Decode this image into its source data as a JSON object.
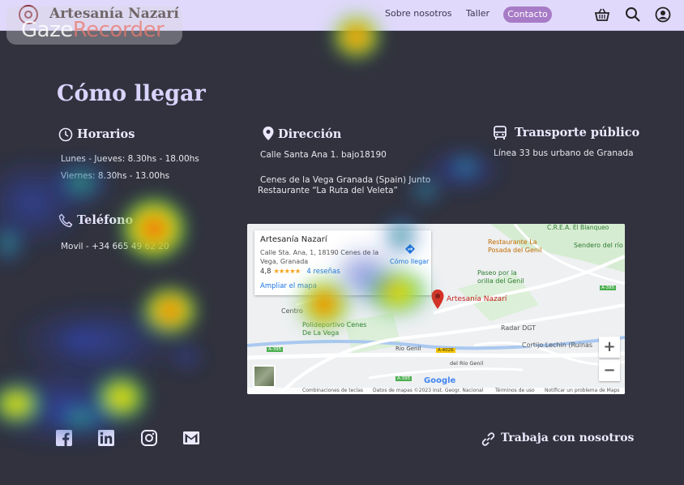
{
  "header": {
    "brand": "Artesanía Nazarí",
    "nav": {
      "about": "Sobre nosotros",
      "taller": "Taller",
      "contact": "Contacto"
    },
    "icons": [
      "basket-icon",
      "search-icon",
      "user-icon"
    ]
  },
  "overlay": {
    "name_a": "Gaze",
    "name_b": "Recorder"
  },
  "page_title": "Cómo llegar",
  "horarios": {
    "heading": "Horarios",
    "line1": "Lunes - Jueves: 8.30hs - 18.00hs",
    "line2": "Viernes: 8.30hs - 13.00hs"
  },
  "direccion": {
    "heading": "Dirección",
    "line1": "Calle Santa Ana 1. bajo18190",
    "line2": "Cenes de la Vega Granada (Spain) Junto",
    "line3": "Restaurante “La Ruta del Veleta”"
  },
  "transporte": {
    "heading": "Transporte público",
    "line1": "Línea 33 bus urbano de Granada"
  },
  "telefono": {
    "heading": "Teléfono",
    "line1": "Movil - +34 665 49 62 20"
  },
  "map": {
    "card_title": "Artesanía Nazarí",
    "card_address": "Calle Sta. Ana, 1, 18190 Cenes de la Vega, Granada",
    "rating": "4,8",
    "stars": "★★★★★",
    "reviews": "4 reseñas",
    "enlarge": "Ampliar el mapa",
    "directions": "Cómo llegar",
    "labels": {
      "pin": "Artesanía Nazarí",
      "restaurant": "Restaurante La Posada del Genil",
      "crea": "C.R.E.A. El Blanqueo",
      "sendero": "Sendero del río",
      "paseo": "Paseo por la orilla del Genil",
      "centro": "Centro",
      "polideportivo": "Polideportivo Cenes De La Vega",
      "radar": "Radar DGT",
      "cortijo": "Cortijo Lechin (Ruinas",
      "rio1": "Río Genil",
      "rio2": "del Río Genil",
      "a395a": "A-395",
      "a395b": "A-395",
      "a395c": "A-395",
      "a4026": "A-4026",
      "google": "Google"
    },
    "zoom_in": "+",
    "zoom_out": "−",
    "footer": {
      "keys": "Combinaciones de teclas",
      "data": "Datos de mapas ©2023 Inst. Geogr. Nacional",
      "terms": "Términos de uso",
      "report": "Notificar un problema de Maps"
    }
  },
  "footer": {
    "social": [
      "facebook-icon",
      "linkedin-icon",
      "instagram-icon",
      "mail-icon"
    ],
    "work_with_us": "Trabaja con nosotros"
  },
  "colors": {
    "background": "#31323d",
    "header": "#e1d9fb",
    "title": "#dad3ff",
    "contact_pill": "#a77bc6",
    "pin": "#d93025"
  }
}
